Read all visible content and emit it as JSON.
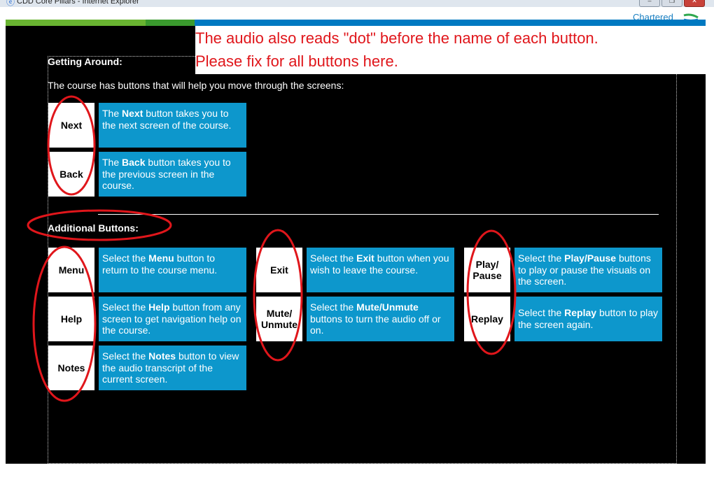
{
  "window": {
    "title": "CDD Core Pillars - Internet Explorer",
    "brand": "Chartered",
    "controls": [
      "–",
      "❐",
      "✕"
    ]
  },
  "colors": {
    "tile_blue": "#0d97cc",
    "stripe_green_light": "#69b431",
    "stripe_green_dark": "#3a9a2e",
    "stripe_blue": "#0079c1",
    "annotation_red": "#e0161b"
  },
  "annotation": {
    "line1": "The audio also reads \"dot\" before the name of each button.",
    "line2": "Please fix for all buttons here."
  },
  "getting_around": {
    "heading": "Getting Around:",
    "intro": "The course has buttons that will help you move through the screens:",
    "items": [
      {
        "button": "Next",
        "pre": "The ",
        "bold": "Next",
        "post": " button takes you to the next screen of the course."
      },
      {
        "button": "Back",
        "pre": "The ",
        "bold": "Back",
        "post": " button takes you to the previous screen in the course."
      }
    ]
  },
  "additional": {
    "heading": "Additional Buttons:",
    "col1": [
      {
        "button": "Menu",
        "pre": "Select the ",
        "bold": "Menu",
        "post": " button to return to the course menu."
      },
      {
        "button": "Help",
        "pre": "Select the ",
        "bold": "Help",
        "post": " button from any screen to get navigation help on the course."
      },
      {
        "button": "Notes",
        "pre": "Select the ",
        "bold": "Notes",
        "post": " button to view the audio transcript of the current screen."
      }
    ],
    "col2": [
      {
        "button": "Exit",
        "pre": "Select the ",
        "bold": "Exit",
        "post": " button when you wish to leave the course."
      },
      {
        "button": "Mute/\nUnmute",
        "pre": "Select the ",
        "bold": "Mute/Unmute",
        "post": " buttons to turn the audio off or on."
      }
    ],
    "col3": [
      {
        "button": "Play/\nPause",
        "pre": "Select the ",
        "bold": "Play/Pause",
        "post": " buttons to play or pause the visuals on the screen."
      },
      {
        "button": "Replay",
        "pre": "Select the ",
        "bold": "Replay",
        "post": " button to play the screen again."
      }
    ]
  }
}
